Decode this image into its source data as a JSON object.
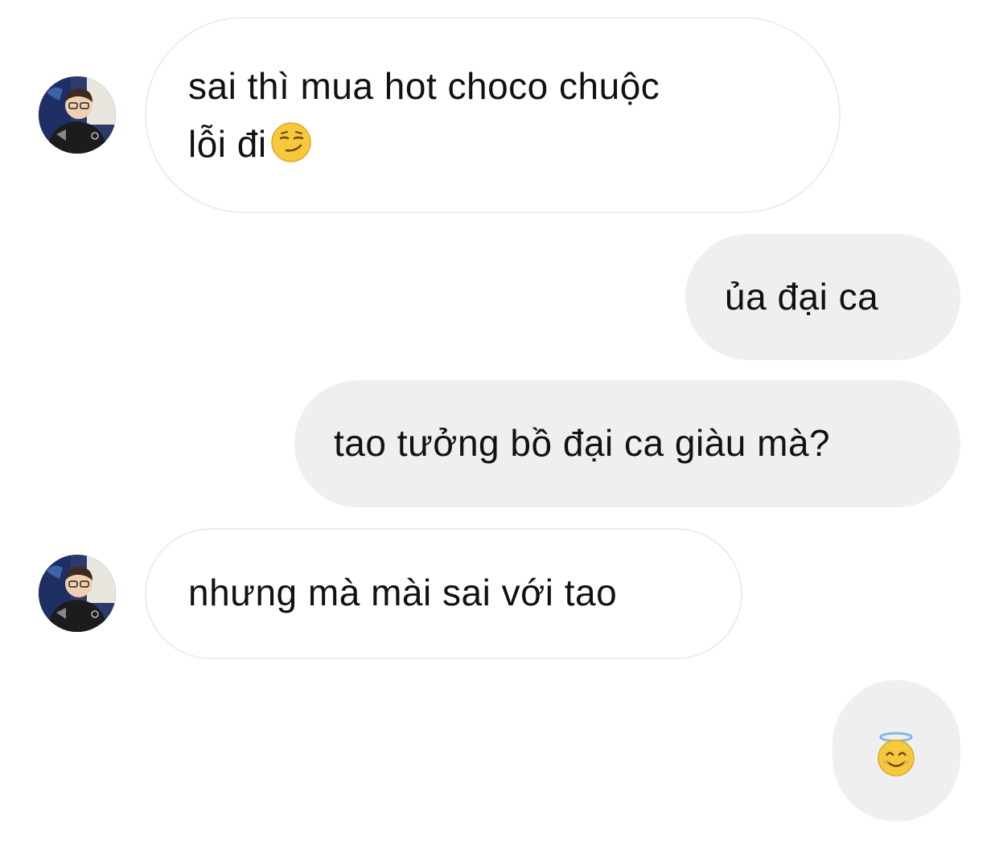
{
  "colors": {
    "background": "#ffffff",
    "incoming_bubble": "#ffffff",
    "incoming_border": "#ececec",
    "outgoing_bubble": "#efefef",
    "text": "#111111"
  },
  "messages": [
    {
      "sender": "contact",
      "text": "sai thì mua hot choco chuộc\nlỗi đi",
      "emoji": "smirking-face-emoji"
    },
    {
      "sender": "me",
      "text": "ủa đại ca"
    },
    {
      "sender": "me",
      "text": "tao tưởng bồ đại ca giàu mà?"
    },
    {
      "sender": "contact",
      "text": "nhưng mà mài sai với tao"
    },
    {
      "sender": "me",
      "emoji": "smiling-face-with-halo-emoji"
    }
  ]
}
